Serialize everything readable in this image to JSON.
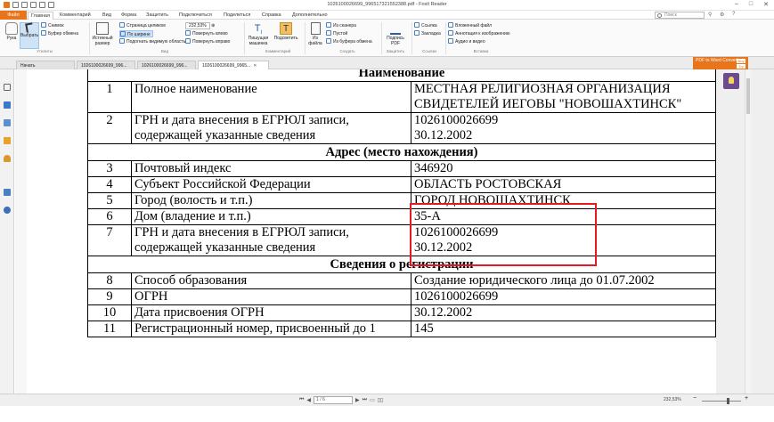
{
  "window": {
    "title": "1026100026699_996517321552388.pdf - Foxit Reader",
    "controls": [
      "–",
      "□",
      "✕"
    ]
  },
  "ribbon_tabs": [
    "Файл",
    "Главная",
    "Комментарий",
    "Вид",
    "Форма",
    "Защитить",
    "Подключиться",
    "Поделиться",
    "Справка",
    "Дополнительно"
  ],
  "search": {
    "placeholder": "Поиск"
  },
  "ribbon": {
    "hand": "Рука",
    "select": "Выбрать",
    "snapshot": "Снимок",
    "clipboard": "Буфер обмена",
    "actual_size": "Истинный размер",
    "fit_page": "Страница целиком",
    "fit_width": "По ширине",
    "fit_visible": "Подогнать видимую область",
    "zoom_value": "232,53%",
    "rotate_left": "Повернуть влево",
    "rotate_right": "Повернуть вправо",
    "typewriter": "Пишущая машинка",
    "highlight": "Подсветить",
    "from_file": "Из файла",
    "from_scanner": "Из сканера",
    "blank": "Пустой",
    "from_clipboard": "Из буфера обмена",
    "sign_pdf": "Подпись PDF",
    "link": "Ссылка",
    "bookmark": "Закладка",
    "attach_file": "Вложенный файл",
    "image_annotation": "Аннотация к изображению",
    "audio_video": "Аудио и видео",
    "groups": [
      "Утилиты",
      "Вид",
      "Комментарий",
      "Создать",
      "Защитить",
      "Ссылки",
      "Вставка"
    ]
  },
  "doc_tabs": [
    "Начать",
    "1026100026699_996...",
    "1026100026699_996...",
    "1026100026699_9965..."
  ],
  "pdf_to_word": {
    "label": "PDF to Word Converter",
    "btn1": "Buy",
    "btn2": "Try"
  },
  "document": {
    "rows": [
      {
        "type": "section",
        "text": "Наименование"
      },
      {
        "type": "row",
        "num": "1",
        "label": "Полное наименование",
        "value": "МЕСТНАЯ РЕЛИГИОЗНАЯ ОРГАНИЗАЦИЯ СВИДЕТЕЛЕЙ ИЕГОВЫ \"НОВОШАХТИНСК\""
      },
      {
        "type": "row",
        "num": "2",
        "label": "ГРН и дата внесения в ЕГРЮЛ записи, содержащей указанные сведения",
        "value": "1026100026699\n30.12.2002"
      },
      {
        "type": "section",
        "text": "Адрес (место нахождения)"
      },
      {
        "type": "row",
        "num": "3",
        "label": "Почтовый индекс",
        "value": "346920"
      },
      {
        "type": "row",
        "num": "4",
        "label": "Субъект Российской Федерации",
        "value": "ОБЛАСТЬ РОСТОВСКАЯ"
      },
      {
        "type": "row",
        "num": "5",
        "label": "Город (волость и т.п.)",
        "value": "ГОРОД НОВОШАХТИНСК"
      },
      {
        "type": "row",
        "num": "6",
        "label": "Дом (владение и т.п.)",
        "value": "35-А"
      },
      {
        "type": "row",
        "num": "7",
        "label": "ГРН и дата внесения в ЕГРЮЛ записи, содержащей указанные сведения",
        "value": "1026100026699\n30.12.2002"
      },
      {
        "type": "section",
        "text": "Сведения о регистрации"
      },
      {
        "type": "row",
        "num": "8",
        "label": "Способ образования",
        "value": "Создание юридического лица до 01.07.2002"
      },
      {
        "type": "row",
        "num": "9",
        "label": "ОГРН",
        "value": "1026100026699"
      },
      {
        "type": "row",
        "num": "10",
        "label": "Дата присвоения ОГРН",
        "value": "30.12.2002"
      },
      {
        "type": "row",
        "num": "11",
        "label": "Регистрационный номер, присвоенный до 1",
        "value": "145"
      }
    ]
  },
  "status": {
    "page": "1 / 6",
    "zoom": "232,53%",
    "zoom_minus": "−",
    "zoom_plus": "+"
  },
  "highlight_color": "#e01b22",
  "accent_color": "#e8741c"
}
